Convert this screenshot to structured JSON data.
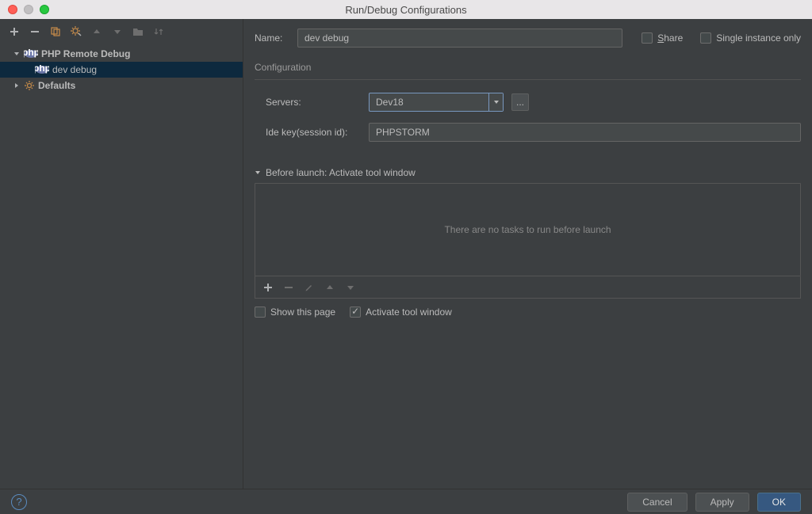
{
  "window": {
    "title": "Run/Debug Configurations"
  },
  "sidebar": {
    "category": "PHP Remote Debug",
    "item": "dev debug",
    "defaults": "Defaults"
  },
  "main": {
    "name_label": "Name:",
    "name_value": "dev debug",
    "share_label": "Share",
    "single_instance_label": "Single instance only",
    "config_section": "Configuration",
    "servers_label": "Servers:",
    "servers_value": "Dev18",
    "ellipsis": "...",
    "ide_key_label": "Ide key(session id):",
    "ide_key_value": "PHPSTORM",
    "before_launch_header": "Before launch: Activate tool window",
    "no_tasks_msg": "There are no tasks to run before launch",
    "show_this_page": "Show this page",
    "activate_tool": "Activate tool window"
  },
  "footer": {
    "cancel": "Cancel",
    "apply": "Apply",
    "ok": "OK"
  }
}
